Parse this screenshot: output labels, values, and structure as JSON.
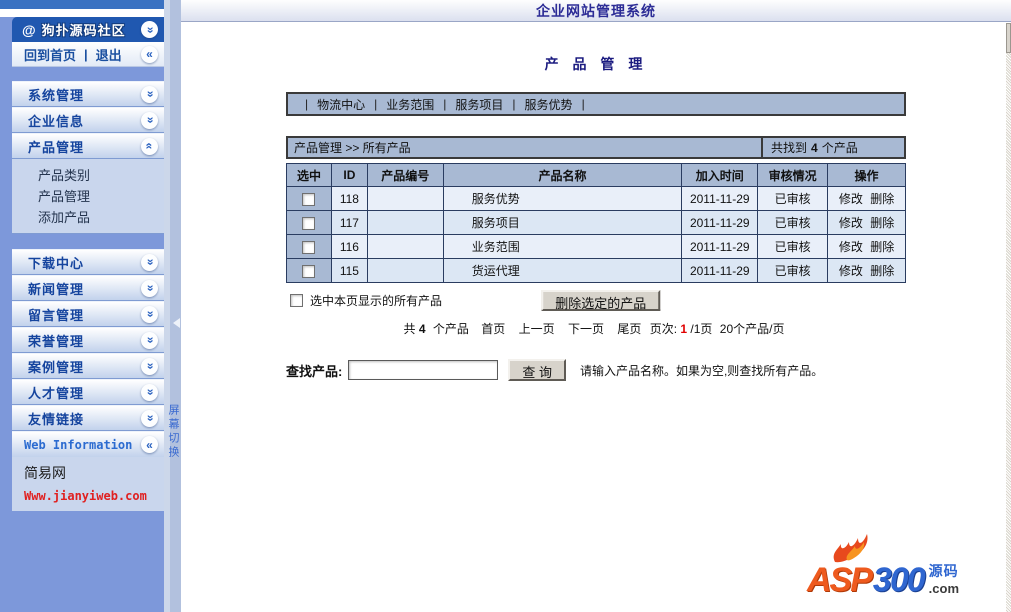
{
  "window": {
    "title": "企业网站管理系统"
  },
  "sidebar": {
    "brand_at": "@",
    "brand": "狗扑源码社区",
    "home": "回到首页",
    "home_sep": "|",
    "logout": "退出",
    "menu": [
      {
        "label": "系统管理"
      },
      {
        "label": "企业信息"
      },
      {
        "label": "产品管理"
      },
      {
        "label": "下载中心"
      },
      {
        "label": "新闻管理"
      },
      {
        "label": "留言管理"
      },
      {
        "label": "荣誉管理"
      },
      {
        "label": "案例管理"
      },
      {
        "label": "人才管理"
      },
      {
        "label": "友情链接"
      }
    ],
    "submenu": [
      {
        "label": "产品类别"
      },
      {
        "label": "产品管理"
      },
      {
        "label": "添加产品"
      }
    ],
    "web_info": {
      "title": "Web Information",
      "site_name": "简易网",
      "site_url": "Www.jianyiweb.com"
    }
  },
  "toggle": {
    "label": "屏幕切换"
  },
  "main": {
    "subtitle": "产 品 管 理",
    "tab_separator": "|",
    "tabs": [
      {
        "label": "物流中心"
      },
      {
        "label": "业务范围"
      },
      {
        "label": "服务项目"
      },
      {
        "label": "服务优势"
      }
    ],
    "breadcrumb": "产品管理 >> 所有产品",
    "found": {
      "prefix": "共找到",
      "count": "4",
      "suffix": "个产品"
    },
    "table": {
      "headers": [
        "选中",
        "ID",
        "产品编号",
        "产品名称",
        "加入时间",
        "审核情况",
        "操作"
      ],
      "rows": [
        {
          "id": "118",
          "code": "",
          "name": "服务优势",
          "date": "2011-11-29",
          "status": "已审核",
          "edit": "修改",
          "delete": "删除"
        },
        {
          "id": "117",
          "code": "",
          "name": "服务项目",
          "date": "2011-11-29",
          "status": "已审核",
          "edit": "修改",
          "delete": "删除"
        },
        {
          "id": "116",
          "code": "",
          "name": "业务范围",
          "date": "2011-11-29",
          "status": "已审核",
          "edit": "修改",
          "delete": "删除"
        },
        {
          "id": "115",
          "code": "",
          "name": "货运代理",
          "date": "2011-11-29",
          "status": "已审核",
          "edit": "修改",
          "delete": "删除"
        }
      ]
    },
    "select_all_label": "选中本页显示的所有产品",
    "delete_button": "删除选定的产品",
    "pagination": {
      "total_prefix": "共",
      "total_count": "4",
      "total_suffix": "个产品",
      "first": "首页",
      "prev": "上一页",
      "next": "下一页",
      "last": "尾页",
      "page_label": "页次:",
      "page_current": "1",
      "page_rest": "/1页",
      "per_page": "20个产品/页"
    },
    "search": {
      "label": "查找产品:",
      "value": "",
      "button": "查 询",
      "hint": "请输入产品名称。如果为空,则查找所有产品。"
    }
  },
  "logo": {
    "asp": "ASP",
    "num": "300",
    "cn": "源码",
    "com": ".com"
  },
  "colors": {
    "accent_blue": "#2058b0",
    "sidebar_base": "#7d98da",
    "panel_blue": "#a8b9d3",
    "row_light": "#e9eff9",
    "row_alt": "#dce7f4",
    "title_navy": "#2c2c96",
    "highlight_red": "#e00000"
  }
}
